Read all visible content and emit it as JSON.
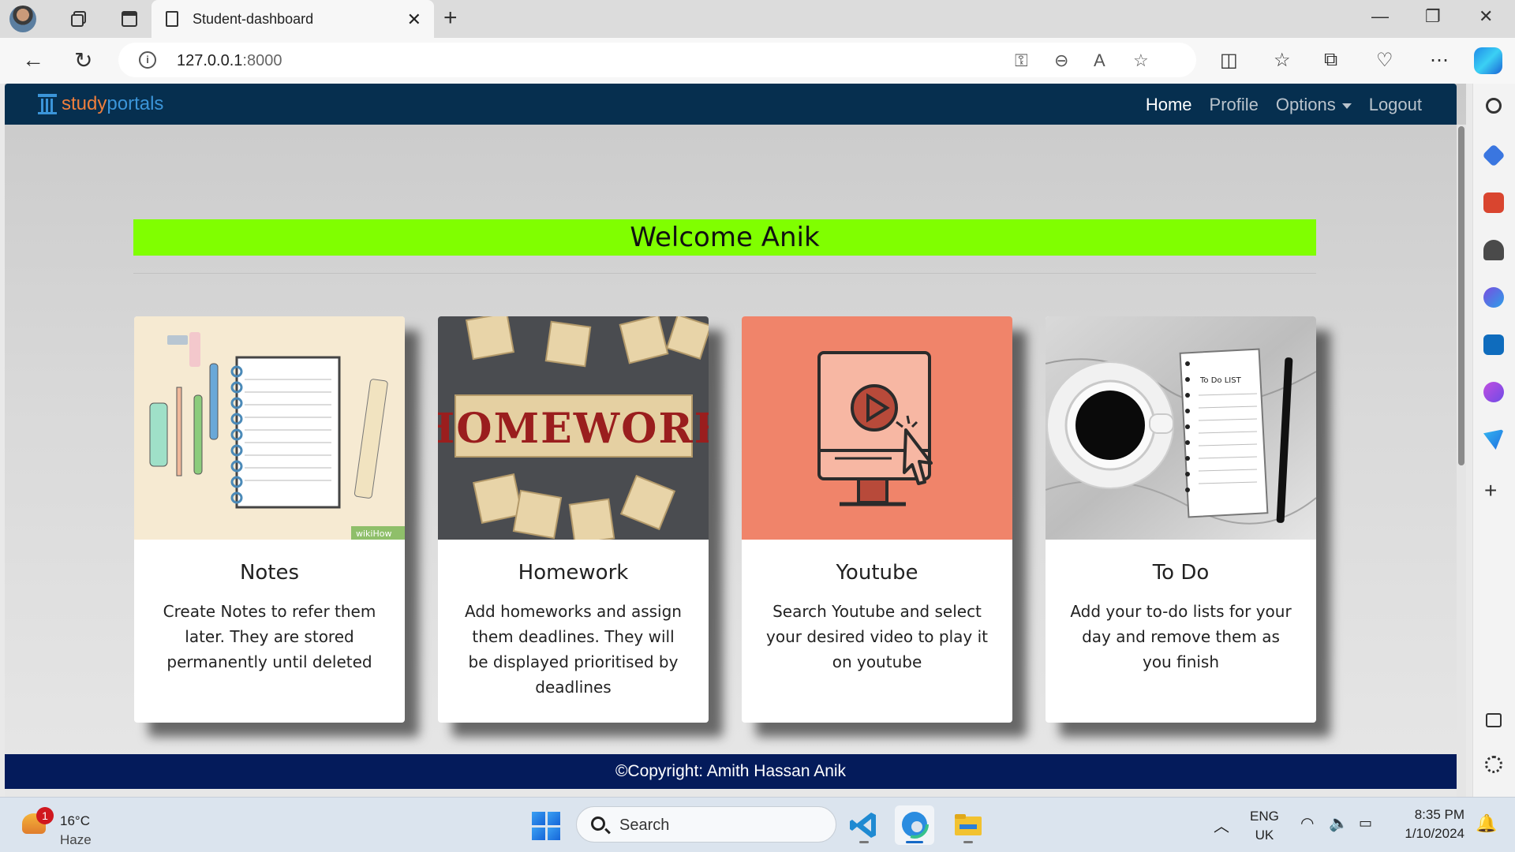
{
  "browser": {
    "tab_title": "Student-dashboard",
    "url_host": "127.0.0.1",
    "url_port": ":8000"
  },
  "app": {
    "brand_part1": "study",
    "brand_part2": "portals",
    "nav": {
      "home": "Home",
      "profile": "Profile",
      "options": "Options",
      "logout": "Logout"
    },
    "welcome": "Welcome Anik",
    "cards": [
      {
        "title": "Notes",
        "description": "Create Notes to refer them later. They are stored permanently until deleted",
        "image_caption": "wikiHow"
      },
      {
        "title": "Homework",
        "description": "Add homeworks and assign them deadlines. They will be displayed prioritised by deadlines",
        "image_text": "HOMEWORK"
      },
      {
        "title": "Youtube",
        "description": "Search Youtube and select your desired video to play it on youtube"
      },
      {
        "title": "To Do",
        "description": "Add your to-do lists for your day and remove them as you finish",
        "image_text": "To Do LIST"
      }
    ],
    "footer": "©Copyright: Amith Hassan Anik"
  },
  "taskbar": {
    "weather_temp": "16°C",
    "weather_cond": "Haze",
    "weather_badge": "1",
    "search_label": "Search",
    "lang_1": "ENG",
    "lang_2": "UK",
    "time": "8:35 PM",
    "date": "1/10/2024"
  },
  "colors": {
    "navbar": "#062f4f",
    "welcome_bg": "#80ff00",
    "footer": "#041b5b",
    "brand_orange": "#f07f3c",
    "brand_blue": "#3b95d9"
  }
}
